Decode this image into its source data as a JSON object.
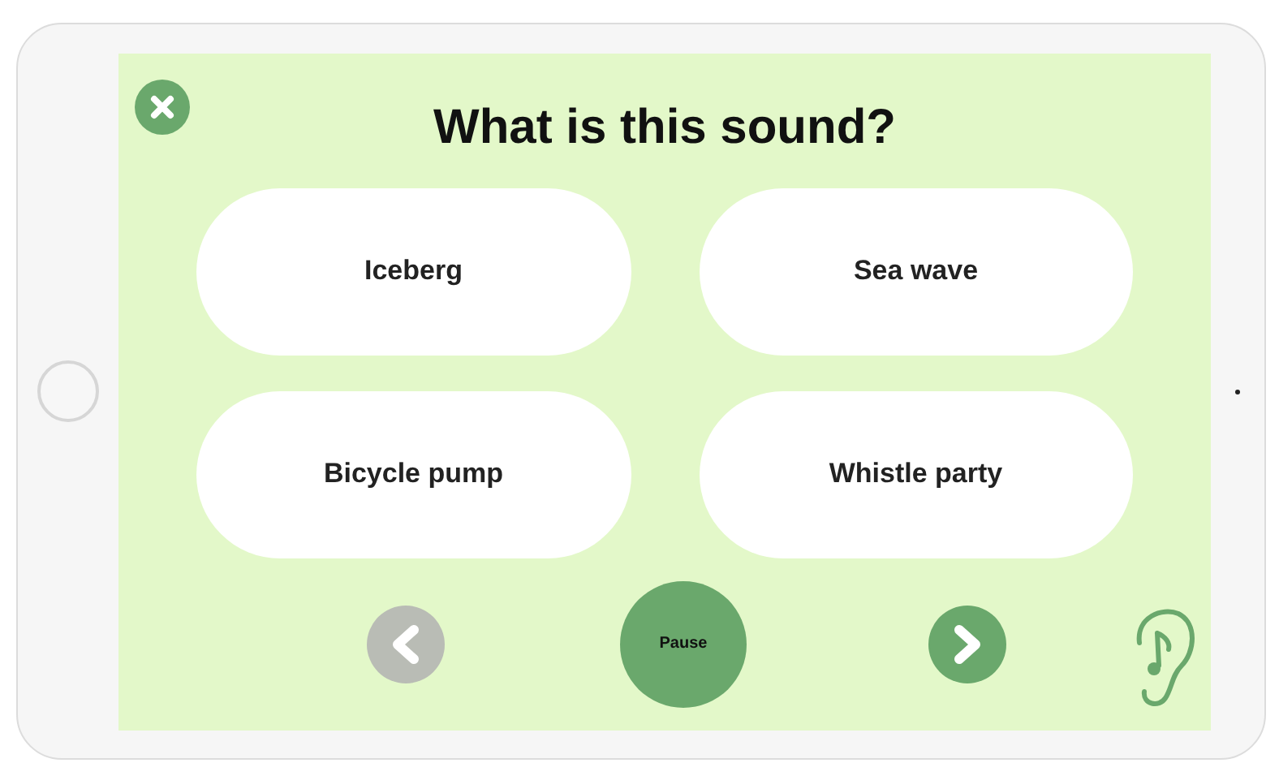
{
  "title": "What is this sound?",
  "answers": [
    {
      "label": "Iceberg"
    },
    {
      "label": "Sea wave"
    },
    {
      "label": "Bicycle pump"
    },
    {
      "label": "Whistle party"
    }
  ],
  "controls": {
    "previous": {
      "disabled": true
    },
    "pause": {
      "label": "Pause"
    },
    "next": {
      "disabled": false
    }
  }
}
